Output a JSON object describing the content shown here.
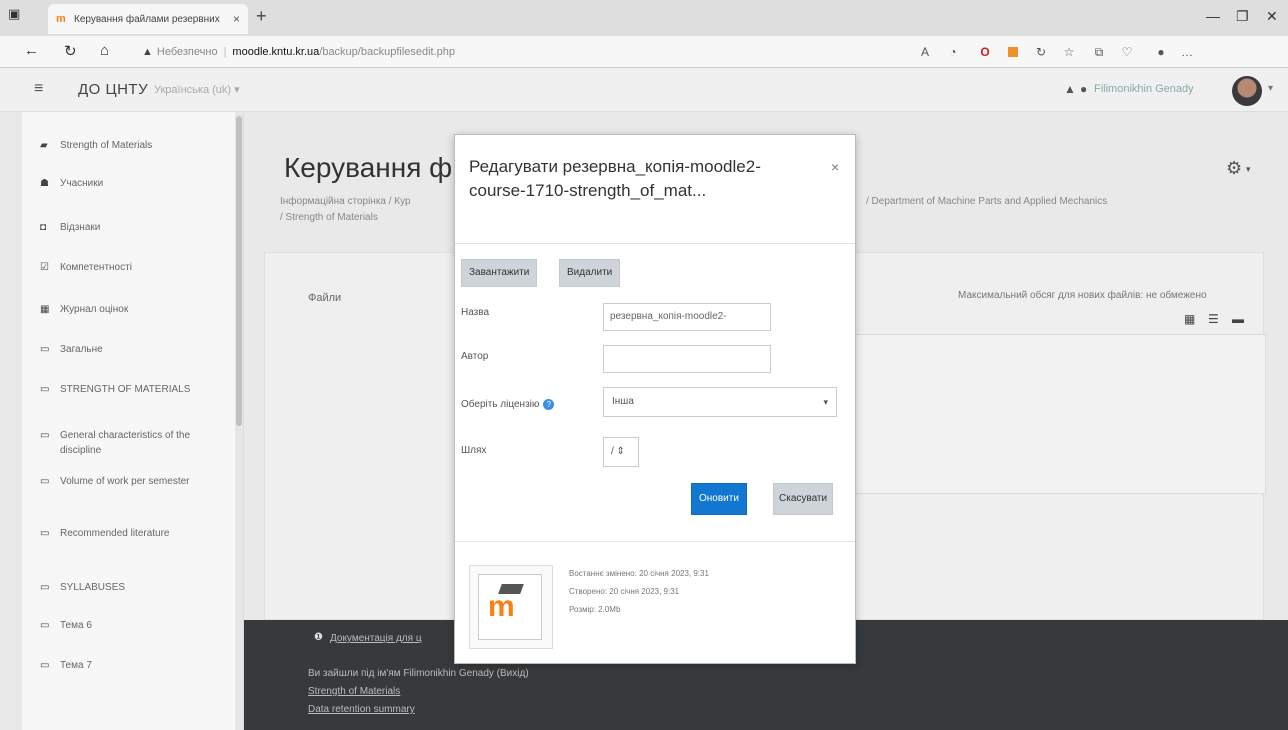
{
  "browser": {
    "tab_title": "Керування файлами резервних",
    "tab_close": "×",
    "new_tab": "+",
    "security_label": "Небезпечно",
    "url_host": "moodle.kntu.kr.ua",
    "url_path": "/backup/backupfilesedit.php"
  },
  "navbar": {
    "brand": "ДО ЦНТУ",
    "language": "Українська (uk) ▾",
    "user_name": "Filimonikhin Genady"
  },
  "sidebar": {
    "items": [
      {
        "icon": "mortarboard-icon",
        "label": "Strength of Materials"
      },
      {
        "icon": "users-icon",
        "label": "Учасники"
      },
      {
        "icon": "badge-icon",
        "label": "Відзнаки"
      },
      {
        "icon": "check-icon",
        "label": "Компетентності"
      },
      {
        "icon": "grades-icon",
        "label": "Журнал оцінок"
      },
      {
        "icon": "folder-icon",
        "label": "Загальне"
      },
      {
        "icon": "folder-icon",
        "label": "STRENGTH OF MATERIALS"
      },
      {
        "icon": "folder-icon",
        "label": "General characteristics of the discipline"
      },
      {
        "icon": "folder-icon",
        "label": "Volume of work per semester"
      },
      {
        "icon": "folder-icon",
        "label": "Recommended literature"
      },
      {
        "icon": "folder-icon",
        "label": "SYLLABUSES"
      },
      {
        "icon": "folder-icon",
        "label": "Тема 6"
      },
      {
        "icon": "folder-icon",
        "label": "Тема 7"
      }
    ]
  },
  "main": {
    "page_title": "Керування ф",
    "breadcrumb_line1": "Інформаційна сторінка / Кур",
    "breadcrumb_line2": "/ Strength of Materials",
    "breadcrumb_right": "/ Department of Machine Parts and Applied Mechanics",
    "files_label": "Файли",
    "max_size_text": "Максимальний обсяг для нових файлів: не обмежено"
  },
  "footer": {
    "docs_link": "Документація для ц",
    "logged_in_text": "Ви зайшли під ім'ям Filimonikhin Genady (Вихід)",
    "course_link": "Strength of Materials",
    "retention_link": "Data retention summary"
  },
  "modal": {
    "title": "Редагувати резервна_копія-moodle2-course-1710-strength_of_mat...",
    "close": "×",
    "download_button": "Завантажити",
    "delete_button": "Видалити",
    "name_label": "Назва",
    "name_value": "резервна_копія-moodle2-",
    "author_label": "Автор",
    "author_value": "",
    "license_label": "Оберіть ліцензію",
    "license_value": "Інша",
    "path_label": "Шлях",
    "path_value": "/ ⇕",
    "update_button": "Оновити",
    "cancel_button": "Скасувати",
    "modified_text": "Востаннє змінено: 20 січня 2023, 9:31",
    "created_text": "Створено: 20 січня 2023, 9:31",
    "size_text": "Розмір: 2.0Mb"
  },
  "colors": {
    "primary_button": "#1177d1",
    "moodle_orange": "#f98012",
    "footer_bg": "#373a3c"
  }
}
